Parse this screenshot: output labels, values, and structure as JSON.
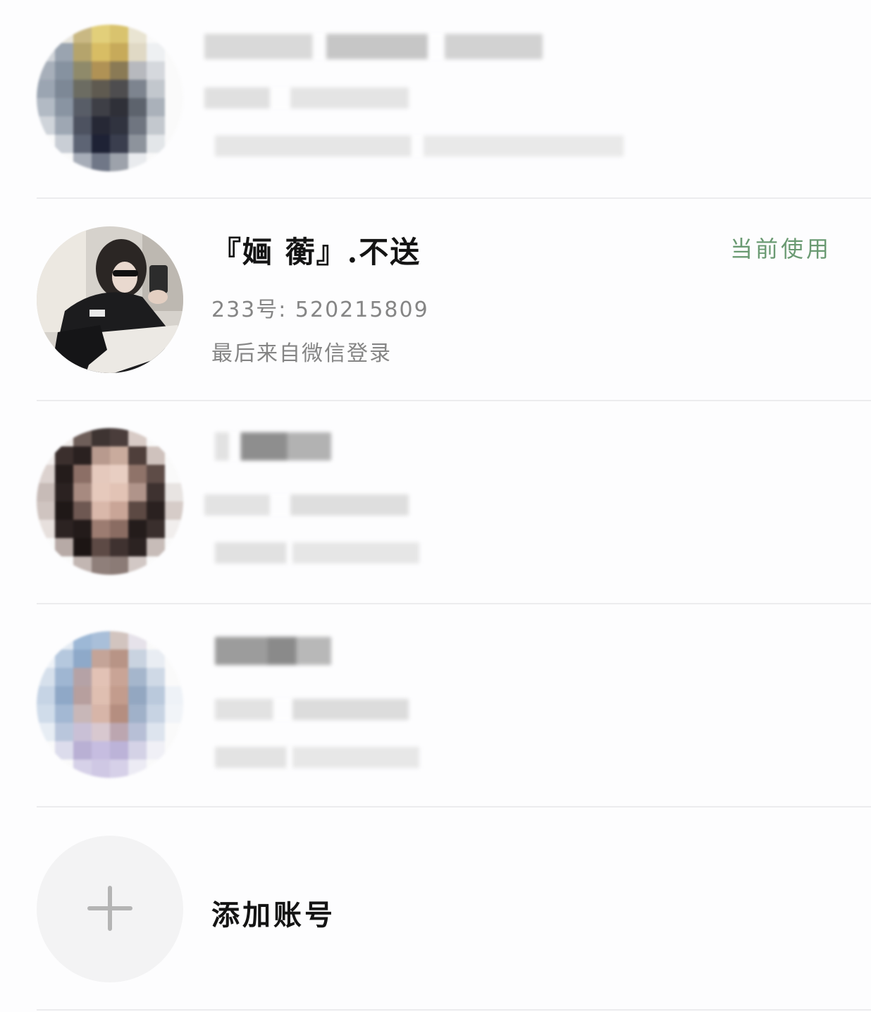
{
  "accounts": [
    {
      "blurred": true,
      "avatar_colors": [
        "#fafafa",
        "#e8e6de",
        "#c9b883",
        "#e2cf7a",
        "#d9c36e",
        "#e9e4d2",
        "#fafafa",
        "#fafafa",
        "#cfd3d8",
        "#9aa4b0",
        "#b5a46c",
        "#d8bd64",
        "#c7aa5a",
        "#e0d9c5",
        "#eef0f2",
        "#fafafa",
        "#a7afba",
        "#8692a0",
        "#8f8a6a",
        "#b09255",
        "#8a7a55",
        "#b7b9be",
        "#d5d8dd",
        "#fafafa",
        "#9ba5b2",
        "#7d8896",
        "#6c6c62",
        "#5f5a50",
        "#4e4d4f",
        "#7d848f",
        "#c2c7cd",
        "#fafafa",
        "#b2bac4",
        "#8994a2",
        "#585d67",
        "#3e3f46",
        "#2f3038",
        "#5d636d",
        "#aab1ba",
        "#fafafa",
        "#cfd4da",
        "#9ea7b3",
        "#4d5260",
        "#262835",
        "#30333f",
        "#6f7580",
        "#c3c8ce",
        "#fafafa",
        "#fafafa",
        "#c9ced5",
        "#5d6474",
        "#1e2235",
        "#3a3e4e",
        "#8d939c",
        "#e3e6e9",
        "#fafafa",
        "#fafafa",
        "#fafafa",
        "#a7adb8",
        "#707787",
        "#9da2ab",
        "#e9ebee",
        "#fafafa",
        "#fafafa"
      ]
    },
    {
      "blurred": false,
      "name": "『婳 蘅』.不送",
      "account_id": "233号: 520215809",
      "last_login": "最后来自微信登录",
      "status": "当前使用"
    },
    {
      "blurred": true,
      "avatar_colors": [
        "#fafafa",
        "#f0ecea",
        "#6e5e59",
        "#3e3432",
        "#4a3d3b",
        "#d8cbc6",
        "#fafafa",
        "#fafafa",
        "#f3efee",
        "#3b2f2d",
        "#2a2120",
        "#b89a8e",
        "#c9ab9d",
        "#4f3f3b",
        "#cfc2bd",
        "#fafafa",
        "#dcd2cf",
        "#241c1b",
        "#8c6f66",
        "#e5c9bd",
        "#e8cec2",
        "#8f7369",
        "#5e4c47",
        "#fafafa",
        "#c7bbb7",
        "#2b2221",
        "#a78a80",
        "#e6c9bc",
        "#e2c3b5",
        "#b0948a",
        "#3e3230",
        "#e8e4e2",
        "#cfc4c0",
        "#1f1817",
        "#6e5852",
        "#d9b8aa",
        "#c9a597",
        "#5c4943",
        "#2a2120",
        "#d6ccc8",
        "#e7e0dd",
        "#2c2322",
        "#231b1a",
        "#9c7c71",
        "#8a6c62",
        "#241c1b",
        "#3a2f2d",
        "#f1eeed",
        "#fafafa",
        "#b7aaa6",
        "#1c1514",
        "#5d4a45",
        "#3f3230",
        "#2c2322",
        "#c7bcb8",
        "#fafafa",
        "#fafafa",
        "#fafafa",
        "#c2b6b2",
        "#8f7f7a",
        "#8b7b76",
        "#d2c8c5",
        "#fafafa",
        "#fafafa"
      ]
    },
    {
      "blurred": true,
      "avatar_colors": [
        "#fafafa",
        "#e4ebf3",
        "#9db8d6",
        "#a9bfd9",
        "#d2c4bf",
        "#e6e2ea",
        "#fafafa",
        "#fafafa",
        "#eef2f7",
        "#b5c8de",
        "#8ea9c9",
        "#c4a498",
        "#b89486",
        "#c9d3e0",
        "#e9edf3",
        "#fafafa",
        "#d6e0ec",
        "#9fb6d2",
        "#b5a2a6",
        "#e2c2b5",
        "#c9a496",
        "#a5b6cc",
        "#cfd9e6",
        "#fafafa",
        "#c6d4e5",
        "#8fa8c7",
        "#b79f9e",
        "#dfbfb1",
        "#c39c8d",
        "#93a7c1",
        "#bac9dc",
        "#eef2f7",
        "#d0dcea",
        "#a3b8d3",
        "#c8b7b8",
        "#d7b5a8",
        "#b58e80",
        "#a0b1c9",
        "#c7d3e3",
        "#f1f4f8",
        "#e7edf4",
        "#b9c6dc",
        "#c9c0d6",
        "#d8c8cf",
        "#bca6b0",
        "#b7bfd6",
        "#dde4ee",
        "#fafafa",
        "#fafafa",
        "#dcdcec",
        "#b9b0d4",
        "#c6bde0",
        "#bcb3d8",
        "#d4d2e6",
        "#f0f0f6",
        "#fafafa",
        "#fafafa",
        "#fafafa",
        "#d6d1e8",
        "#cfc8e4",
        "#d6d0e8",
        "#ecebf4",
        "#fafafa",
        "#fafafa"
      ]
    }
  ],
  "add_account": {
    "label": "添加账号"
  }
}
